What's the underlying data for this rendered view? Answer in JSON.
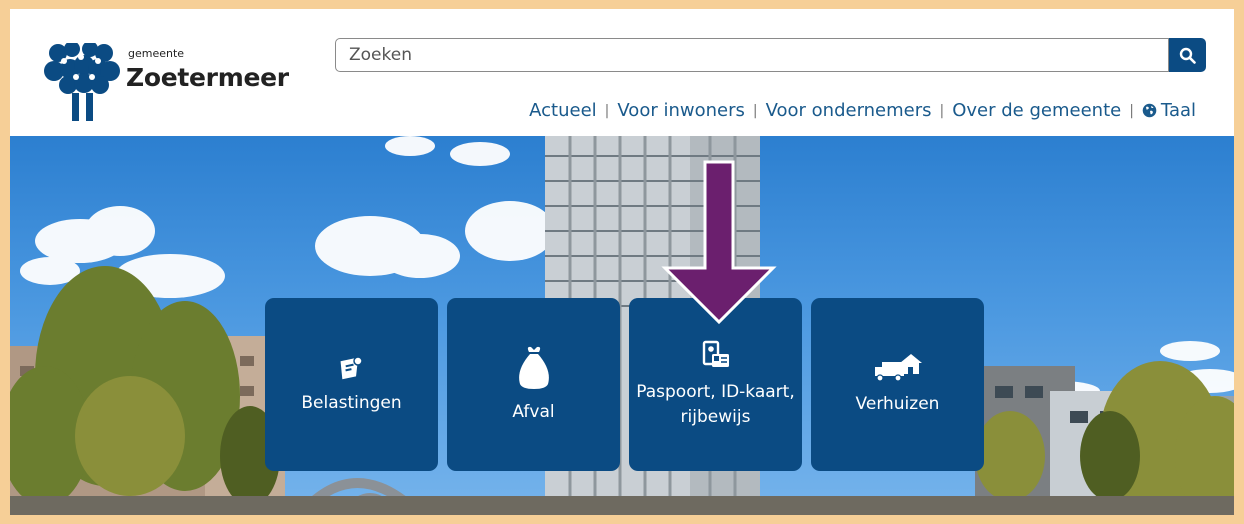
{
  "header": {
    "brand_small": "gemeente",
    "brand_big": "Zoetermeer",
    "logo_icon": "zoetermeer-tree-logo-icon",
    "brand_color": "#0b4b83"
  },
  "search": {
    "placeholder": "Zoeken",
    "button_icon": "search-icon"
  },
  "nav": {
    "items": [
      {
        "label": "Actueel"
      },
      {
        "label": "Voor inwoners"
      },
      {
        "label": "Voor ondernemers"
      },
      {
        "label": "Over de gemeente"
      },
      {
        "label": "Taal",
        "icon": "globe-icon"
      }
    ],
    "separator": "|"
  },
  "tiles": [
    {
      "label": "Belastingen",
      "icon": "tax-receipt-icon"
    },
    {
      "label": "Afval",
      "icon": "garbage-bag-icon"
    },
    {
      "label": "Paspoort, ID-kaart, rijbewijs",
      "icon": "id-card-icon"
    },
    {
      "label": "Verhuizen",
      "icon": "moving-truck-icon"
    }
  ],
  "annotation": {
    "arrow_icon": "down-arrow-icon",
    "arrow_color": "#6b1f6e"
  }
}
